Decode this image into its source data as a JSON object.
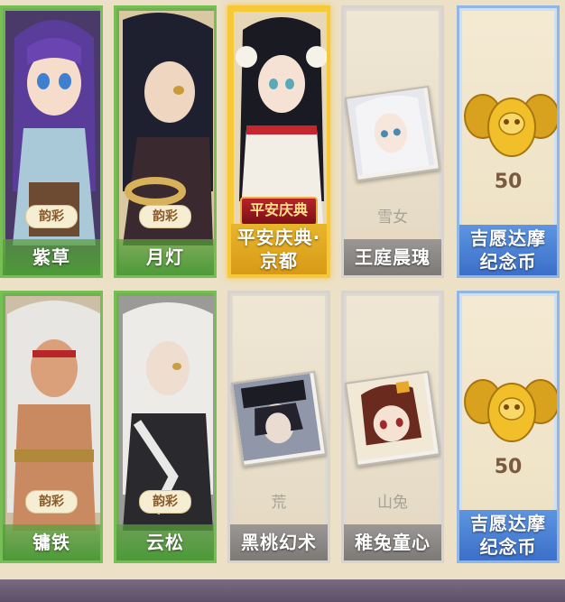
{
  "rows": [
    [
      {
        "type": "skin",
        "name": "紫草",
        "badge": "韵彩"
      },
      {
        "type": "skin",
        "name": "月灯",
        "badge": "韵彩"
      },
      {
        "type": "featured",
        "name_line1": "平安庆典·",
        "name_line2": "京都",
        "banner": "平安庆典"
      },
      {
        "type": "item",
        "name": "王庭晨瑰",
        "sub": "雪女"
      },
      {
        "type": "coin",
        "name_line1": "吉愿达摩",
        "name_line2": "纪念币",
        "count": "50"
      }
    ],
    [
      {
        "type": "skin",
        "name": "镛铁",
        "badge": "韵彩"
      },
      {
        "type": "skin",
        "name": "云松",
        "badge": "韵彩"
      },
      {
        "type": "item",
        "name": "黑桃幻术",
        "sub": "荒"
      },
      {
        "type": "item",
        "name": "稚兔童心",
        "sub": "山兔"
      },
      {
        "type": "coin",
        "name_line1": "吉愿达摩",
        "name_line2": "纪念币",
        "count": "50"
      }
    ]
  ]
}
